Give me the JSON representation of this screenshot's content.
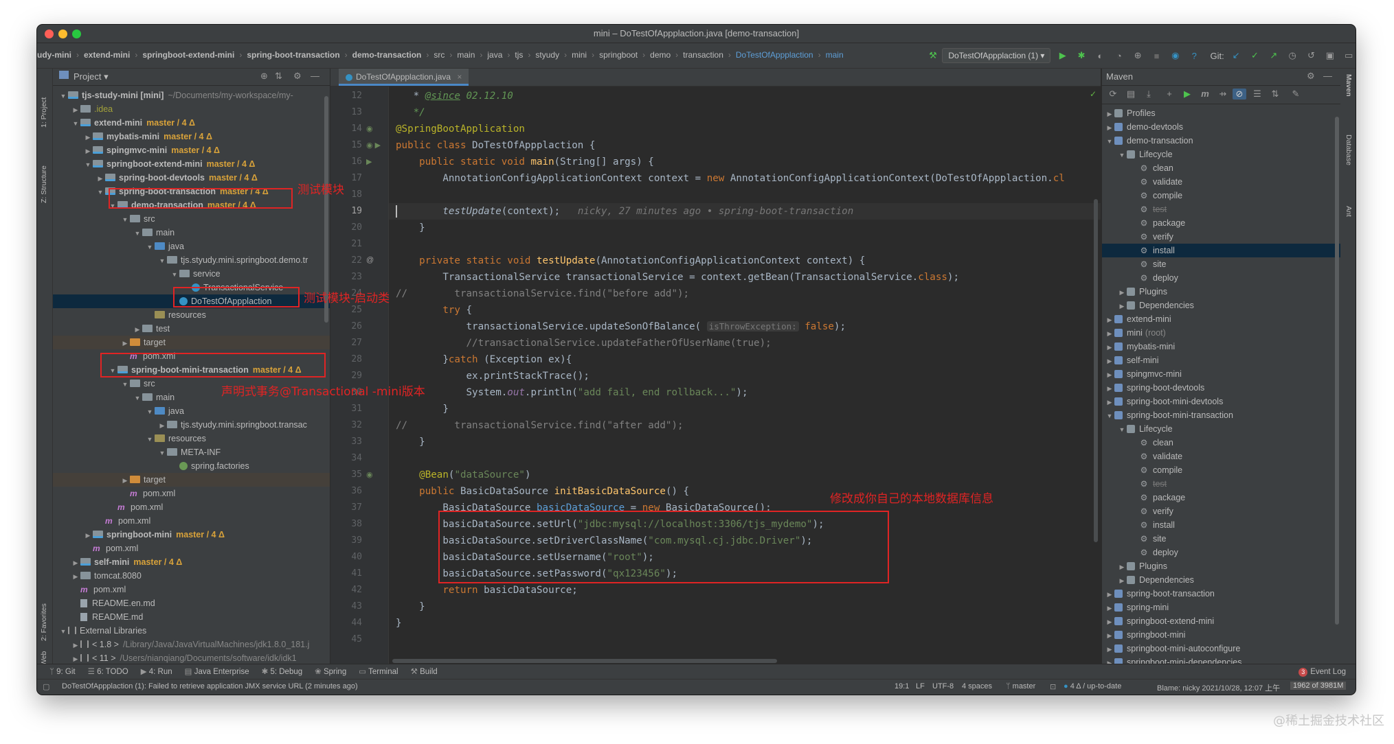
{
  "window": {
    "title": "mini – DoTestOfAppplaction.java [demo-transaction]"
  },
  "breadcrumbs": [
    "udy-mini",
    "extend-mini",
    "springboot-extend-mini",
    "spring-boot-transaction",
    "demo-transaction",
    "src",
    "main",
    "java",
    "tjs",
    "styudy",
    "mini",
    "springboot",
    "demo",
    "transaction",
    "DoTestOfAppplaction",
    "main"
  ],
  "toolbar": {
    "run_config": "DoTestOfAppplaction (1)",
    "git_label": "Git:"
  },
  "left_strip": {
    "project": "1: Project",
    "structure": "Z: Structure",
    "favorites": "2: Favorites",
    "web": "Web"
  },
  "right_strip": {
    "maven": "Maven",
    "database": "Database",
    "ant": "Ant"
  },
  "project_panel": {
    "title": "Project",
    "tree": [
      {
        "d": 0,
        "arr": "▼",
        "icon": "mod",
        "label": "tjs-study-mini [mini]",
        "bold": true,
        "hint": "~/Documents/my-workspace/my-"
      },
      {
        "d": 1,
        "arr": "▶",
        "icon": "idea",
        "label": ".idea",
        "color": "#a3a23a"
      },
      {
        "d": 1,
        "arr": "▼",
        "icon": "mod",
        "label": "extend-mini",
        "bold": true,
        "branch": "master / 4 Δ"
      },
      {
        "d": 2,
        "arr": "▶",
        "icon": "mod",
        "label": "mybatis-mini",
        "bold": true,
        "branch": "master / 4 Δ"
      },
      {
        "d": 2,
        "arr": "▶",
        "icon": "mod",
        "label": "spingmvc-mini",
        "bold": true,
        "branch": "master / 4 Δ"
      },
      {
        "d": 2,
        "arr": "▼",
        "icon": "mod",
        "label": "springboot-extend-mini",
        "bold": true,
        "branch": "master / 4 Δ"
      },
      {
        "d": 3,
        "arr": "▶",
        "icon": "mod",
        "label": "spring-boot-devtools",
        "bold": true,
        "branch": "master / 4 Δ"
      },
      {
        "d": 3,
        "arr": "▼",
        "icon": "mod",
        "label": "spring-boot-transaction",
        "bold": true,
        "branch": "master / 4 Δ"
      },
      {
        "d": 4,
        "arr": "▼",
        "icon": "mod",
        "label": "demo-transaction",
        "bold": true,
        "branch": "master / 4 Δ"
      },
      {
        "d": 5,
        "arr": "▼",
        "icon": "folder",
        "label": "src"
      },
      {
        "d": 6,
        "arr": "▼",
        "icon": "folder",
        "label": "main"
      },
      {
        "d": 7,
        "arr": "▼",
        "icon": "src",
        "label": "java"
      },
      {
        "d": 8,
        "arr": "▼",
        "icon": "folder",
        "label": "tjs.styudy.mini.springboot.demo.tr"
      },
      {
        "d": 9,
        "arr": "▼",
        "icon": "folder",
        "label": "service"
      },
      {
        "d": 10,
        "arr": "",
        "icon": "cls",
        "label": "TransactionalService"
      },
      {
        "d": 9,
        "arr": "",
        "icon": "cls",
        "label": "DoTestOfAppplaction",
        "sel": true
      },
      {
        "d": 7,
        "arr": "",
        "icon": "res",
        "label": "resources"
      },
      {
        "d": 6,
        "arr": "▶",
        "icon": "folder",
        "label": "test"
      },
      {
        "d": 5,
        "arr": "▶",
        "icon": "tgt",
        "label": "target",
        "hl": true
      },
      {
        "d": 5,
        "arr": "",
        "icon": "m",
        "label": "pom.xml"
      },
      {
        "d": 4,
        "arr": "▼",
        "icon": "mod",
        "label": "spring-boot-mini-transaction",
        "bold": true,
        "branch": "master / 4 Δ"
      },
      {
        "d": 5,
        "arr": "▼",
        "icon": "folder",
        "label": "src"
      },
      {
        "d": 6,
        "arr": "▼",
        "icon": "folder",
        "label": "main"
      },
      {
        "d": 7,
        "arr": "▼",
        "icon": "src",
        "label": "java"
      },
      {
        "d": 8,
        "arr": "▶",
        "icon": "folder",
        "label": "tjs.styudy.mini.springboot.transac"
      },
      {
        "d": 7,
        "arr": "▼",
        "icon": "res",
        "label": "resources"
      },
      {
        "d": 8,
        "arr": "▼",
        "icon": "folder",
        "label": "META-INF"
      },
      {
        "d": 9,
        "arr": "",
        "icon": "spr",
        "label": "spring.factories"
      },
      {
        "d": 5,
        "arr": "▶",
        "icon": "tgt",
        "label": "target",
        "hl": true
      },
      {
        "d": 5,
        "arr": "",
        "icon": "m",
        "label": "pom.xml"
      },
      {
        "d": 4,
        "arr": "",
        "icon": "m",
        "label": "pom.xml"
      },
      {
        "d": 3,
        "arr": "",
        "icon": "m",
        "label": "pom.xml"
      },
      {
        "d": 2,
        "arr": "▶",
        "icon": "mod",
        "label": "springboot-mini",
        "bold": true,
        "branch": "master / 4 Δ"
      },
      {
        "d": 2,
        "arr": "",
        "icon": "m",
        "label": "pom.xml"
      },
      {
        "d": 1,
        "arr": "▶",
        "icon": "mod",
        "label": "self-mini",
        "bold": true,
        "branch": "master / 4 Δ"
      },
      {
        "d": 1,
        "arr": "▶",
        "icon": "folder",
        "label": "tomcat.8080"
      },
      {
        "d": 1,
        "arr": "",
        "icon": "m",
        "label": "pom.xml"
      },
      {
        "d": 1,
        "arr": "",
        "icon": "txt",
        "label": "README.en.md"
      },
      {
        "d": 1,
        "arr": "",
        "icon": "txt",
        "label": "README.md"
      },
      {
        "d": 0,
        "arr": "▼",
        "icon": "lib",
        "label": "External Libraries"
      },
      {
        "d": 1,
        "arr": "▶",
        "icon": "lib",
        "label": "< 1.8 >",
        "hint": "/Library/Java/JavaVirtualMachines/jdk1.8.0_181.j"
      },
      {
        "d": 1,
        "arr": "▶",
        "icon": "lib",
        "label": "< 11 >",
        "hint": "/Users/nianqiang/Documents/software/idk/idk1"
      }
    ]
  },
  "editor": {
    "tab": "DoTestOfAppplaction.java",
    "current_line": 19,
    "lines": [
      {
        "n": 12,
        "h": "   * <span class=\"tag\">@since</span><span class=\"cd\"> 02.12.10</span>",
        "cls": "cd"
      },
      {
        "n": 13,
        "h": "<span class=\"cd\">   */</span>"
      },
      {
        "n": 14,
        "h": "<span class=\"a\">@SpringBootApplication</span>"
      },
      {
        "n": 15,
        "h": "<span class=\"k\">public class </span>DoTestOfAppplaction {"
      },
      {
        "n": 16,
        "h": "    <span class=\"k\">public static void </span><span class=\"f\">main</span>(String[] args) {"
      },
      {
        "n": 17,
        "h": "        AnnotationConfigApplicationContext context = <span class=\"k\">new </span>AnnotationConfigApplicationContext(DoTestOfAppplaction.<span class=\"k\">cl</span>"
      },
      {
        "n": 18,
        "h": ""
      },
      {
        "n": 19,
        "h": "        <span class=\"it\">testUpdate</span>(context);   <span class=\"blame\">nicky, 27 minutes ago • spring-boot-transaction</span>"
      },
      {
        "n": 20,
        "h": "    }"
      },
      {
        "n": 21,
        "h": ""
      },
      {
        "n": 22,
        "h": "    <span class=\"k\">private static void </span><span class=\"f\">testUpdate</span>(AnnotationConfigApplicationContext context) {"
      },
      {
        "n": 23,
        "h": "        TransactionalService transactionalService = context.getBean(TransactionalService.<span class=\"k\">class</span>);"
      },
      {
        "n": 24,
        "h": "<span class=\"c\">//        transactionalService.find(\"before add\");</span>"
      },
      {
        "n": 25,
        "h": "        <span class=\"k\">try </span>{"
      },
      {
        "n": 26,
        "h": "            transactionalService.updateSonOfBalance( <span class=\"hint\">isThrowException:</span> <span class=\"k\">false</span>);"
      },
      {
        "n": 27,
        "h": "            <span class=\"c\">//transactionalService.updateFatherOfUserName(true);</span>"
      },
      {
        "n": 28,
        "h": "        }<span class=\"k\">catch </span>(Exception ex){"
      },
      {
        "n": 29,
        "h": "            ex.printStackTrace();"
      },
      {
        "n": 30,
        "h": "            System.<span class=\"fld it\">out</span>.println(<span class=\"s\">\"add fail, end rollback...\"</span>);"
      },
      {
        "n": 31,
        "h": "        }"
      },
      {
        "n": 32,
        "h": "<span class=\"c\">//        transactionalService.find(\"after add\");</span>"
      },
      {
        "n": 33,
        "h": "    }"
      },
      {
        "n": 34,
        "h": ""
      },
      {
        "n": 35,
        "h": "    <span class=\"a\">@Bean</span>(<span class=\"s\">\"dataSource\"</span>)"
      },
      {
        "n": 36,
        "h": "    <span class=\"k\">public </span>BasicDataSource <span class=\"f\">initBasicDataSource</span>() {"
      },
      {
        "n": 37,
        "h": "        BasicDataSource <span class=\"ufld\">basicDataSource</span> = <span class=\"k\">new </span>BasicDataSource();"
      },
      {
        "n": 38,
        "h": "        basicDataSource.setUrl(<span class=\"s\">\"jdbc:mysql://localhost:3306/tjs_mydemo\"</span>);"
      },
      {
        "n": 39,
        "h": "        basicDataSource.setDriverClassName(<span class=\"s\">\"com.mysql.cj.jdbc.Driver\"</span>);"
      },
      {
        "n": 40,
        "h": "        basicDataSource.setUsername(<span class=\"s\">\"root\"</span>);"
      },
      {
        "n": 41,
        "h": "        basicDataSource.setPassword(<span class=\"s\">\"qx123456\"</span>);"
      },
      {
        "n": 42,
        "h": "        <span class=\"k\">return </span>basicDataSource;"
      },
      {
        "n": 43,
        "h": "    }"
      },
      {
        "n": 44,
        "h": "}"
      },
      {
        "n": 45,
        "h": ""
      }
    ]
  },
  "maven_panel": {
    "title": "Maven",
    "tree": [
      {
        "d": 0,
        "arr": "▶",
        "icon": "fold",
        "label": "Profiles"
      },
      {
        "d": 0,
        "arr": "▶",
        "icon": "mvn",
        "label": "demo-devtools"
      },
      {
        "d": 0,
        "arr": "▼",
        "icon": "mvn",
        "label": "demo-transaction"
      },
      {
        "d": 1,
        "arr": "▼",
        "icon": "fold",
        "label": "Lifecycle"
      },
      {
        "d": 2,
        "arr": "",
        "icon": "gear",
        "label": "clean"
      },
      {
        "d": 2,
        "arr": "",
        "icon": "gear",
        "label": "validate"
      },
      {
        "d": 2,
        "arr": "",
        "icon": "gear",
        "label": "compile"
      },
      {
        "d": 2,
        "arr": "",
        "icon": "gear",
        "label": "test",
        "strike": true
      },
      {
        "d": 2,
        "arr": "",
        "icon": "gear",
        "label": "package"
      },
      {
        "d": 2,
        "arr": "",
        "icon": "gear",
        "label": "verify"
      },
      {
        "d": 2,
        "arr": "",
        "icon": "gear",
        "label": "install",
        "sel": true
      },
      {
        "d": 2,
        "arr": "",
        "icon": "gear",
        "label": "site"
      },
      {
        "d": 2,
        "arr": "",
        "icon": "gear",
        "label": "deploy"
      },
      {
        "d": 1,
        "arr": "▶",
        "icon": "fold",
        "label": "Plugins"
      },
      {
        "d": 1,
        "arr": "▶",
        "icon": "fold",
        "label": "Dependencies"
      },
      {
        "d": 0,
        "arr": "▶",
        "icon": "mvn",
        "label": "extend-mini"
      },
      {
        "d": 0,
        "arr": "▶",
        "icon": "mvn",
        "label": "mini",
        "hint": "(root)"
      },
      {
        "d": 0,
        "arr": "▶",
        "icon": "mvn",
        "label": "mybatis-mini"
      },
      {
        "d": 0,
        "arr": "▶",
        "icon": "mvn",
        "label": "self-mini"
      },
      {
        "d": 0,
        "arr": "▶",
        "icon": "mvn",
        "label": "spingmvc-mini"
      },
      {
        "d": 0,
        "arr": "▶",
        "icon": "mvn",
        "label": "spring-boot-devtools"
      },
      {
        "d": 0,
        "arr": "▶",
        "icon": "mvn",
        "label": "spring-boot-mini-devtools"
      },
      {
        "d": 0,
        "arr": "▼",
        "icon": "mvn",
        "label": "spring-boot-mini-transaction"
      },
      {
        "d": 1,
        "arr": "▼",
        "icon": "fold",
        "label": "Lifecycle"
      },
      {
        "d": 2,
        "arr": "",
        "icon": "gear",
        "label": "clean"
      },
      {
        "d": 2,
        "arr": "",
        "icon": "gear",
        "label": "validate"
      },
      {
        "d": 2,
        "arr": "",
        "icon": "gear",
        "label": "compile"
      },
      {
        "d": 2,
        "arr": "",
        "icon": "gear",
        "label": "test",
        "strike": true
      },
      {
        "d": 2,
        "arr": "",
        "icon": "gear",
        "label": "package"
      },
      {
        "d": 2,
        "arr": "",
        "icon": "gear",
        "label": "verify"
      },
      {
        "d": 2,
        "arr": "",
        "icon": "gear",
        "label": "install"
      },
      {
        "d": 2,
        "arr": "",
        "icon": "gear",
        "label": "site"
      },
      {
        "d": 2,
        "arr": "",
        "icon": "gear",
        "label": "deploy"
      },
      {
        "d": 1,
        "arr": "▶",
        "icon": "fold",
        "label": "Plugins"
      },
      {
        "d": 1,
        "arr": "▶",
        "icon": "fold",
        "label": "Dependencies"
      },
      {
        "d": 0,
        "arr": "▶",
        "icon": "mvn",
        "label": "spring-boot-transaction"
      },
      {
        "d": 0,
        "arr": "▶",
        "icon": "mvn",
        "label": "spring-mini"
      },
      {
        "d": 0,
        "arr": "▶",
        "icon": "mvn",
        "label": "springboot-extend-mini"
      },
      {
        "d": 0,
        "arr": "▶",
        "icon": "mvn",
        "label": "springboot-mini"
      },
      {
        "d": 0,
        "arr": "▶",
        "icon": "mvn",
        "label": "springboot-mini-autoconfigure"
      },
      {
        "d": 0,
        "arr": "▶",
        "icon": "mvn",
        "label": "springboot-mini-dependencies"
      }
    ]
  },
  "tool_windows": [
    "9: Git",
    "6: TODO",
    "4: Run",
    "Java Enterprise",
    "5: Debug",
    "Spring",
    "Terminal",
    "Build"
  ],
  "event_log": "Event Log",
  "event_log_count": "3",
  "status": {
    "message": "DoTestOfAppplaction (1): Failed to retrieve application JMX service URL (2 minutes ago)",
    "position": "19:1",
    "line_sep": "LF",
    "encoding": "UTF-8",
    "indent": "4 spaces",
    "branch": "master",
    "vcs": "4 Δ / up-to-date",
    "blame": "Blame: nicky 2021/10/28, 12:07 上午",
    "memory": "1962 of 3981M"
  },
  "annotations": {
    "test_module": "测试模块",
    "startup_class": "测试模块-启动类",
    "mini_version": "声明式事务@Transactional -mini版本",
    "db_info": "修改成你自己的本地数据库信息"
  },
  "watermark": "@稀土掘金技术社区"
}
